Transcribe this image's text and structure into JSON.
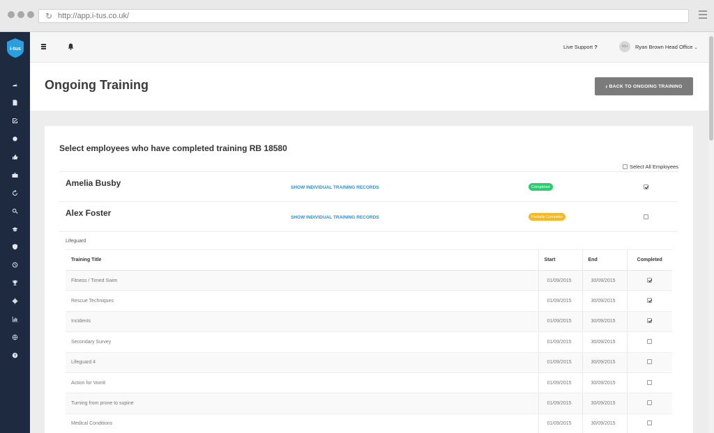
{
  "browser": {
    "url": "http://app.i-tus.co.uk/"
  },
  "brand": {
    "logo_text": "i-tus",
    "accent": "#2a8fd0"
  },
  "sidebar": {
    "icons": [
      "dashboard-icon",
      "document-icon",
      "checklist-icon",
      "asterisk-icon",
      "thumbs-up-icon",
      "briefcase-icon",
      "refresh-icon",
      "search-icon",
      "graduation-icon",
      "shield-icon",
      "clock-icon",
      "trophy-icon",
      "gear-icon",
      "bar-chart-icon",
      "globe-icon",
      "help-icon"
    ]
  },
  "topbar": {
    "live_support": "Live Support",
    "help_glyph": "?",
    "avatar_initials": "RH",
    "user_label": "Ryan Brown Head Office"
  },
  "header": {
    "title": "Ongoing Training",
    "back_button": "BACK TO ONGOING TRAINING"
  },
  "card": {
    "title": "Select employees who have completed training RB 18580",
    "select_all_label": "Select All Employees",
    "select_all_checked": false,
    "employees": [
      {
        "name": "Amelia Busby",
        "link": "SHOW INDIVIDUAL TRAINING RECORDS",
        "status": "Completed",
        "status_color": "#2ecc71",
        "checked": true
      },
      {
        "name": "Alex Foster",
        "link": "SHOW INDIVIDUAL TRAINING RECORDS",
        "status": "Partially Complete",
        "status_color": "#f5b922",
        "checked": false
      }
    ],
    "section_label": "Lifeguard",
    "table": {
      "headers": [
        "Training Title",
        "Start",
        "End",
        "Completed"
      ],
      "rows": [
        {
          "title": "Fitness / Timed Swim",
          "start": "01/09/2015",
          "end": "30/09/2015",
          "completed": true
        },
        {
          "title": "Rescue Techniques",
          "start": "01/09/2015",
          "end": "30/09/2015",
          "completed": true
        },
        {
          "title": "Incidents",
          "start": "01/09/2015",
          "end": "30/09/2015",
          "completed": true
        },
        {
          "title": "Secondary Survey",
          "start": "01/09/2015",
          "end": "30/09/2015",
          "completed": false
        },
        {
          "title": "Lifeguard 4",
          "start": "01/09/2015",
          "end": "30/09/2015",
          "completed": false
        },
        {
          "title": "Action for Vomit",
          "start": "01/09/2015",
          "end": "30/09/2015",
          "completed": false
        },
        {
          "title": "Turning from prone to supine",
          "start": "01/09/2015",
          "end": "30/09/2015",
          "completed": false
        },
        {
          "title": "Medical Conditions",
          "start": "01/09/2015",
          "end": "30/09/2015",
          "completed": false
        }
      ]
    }
  }
}
